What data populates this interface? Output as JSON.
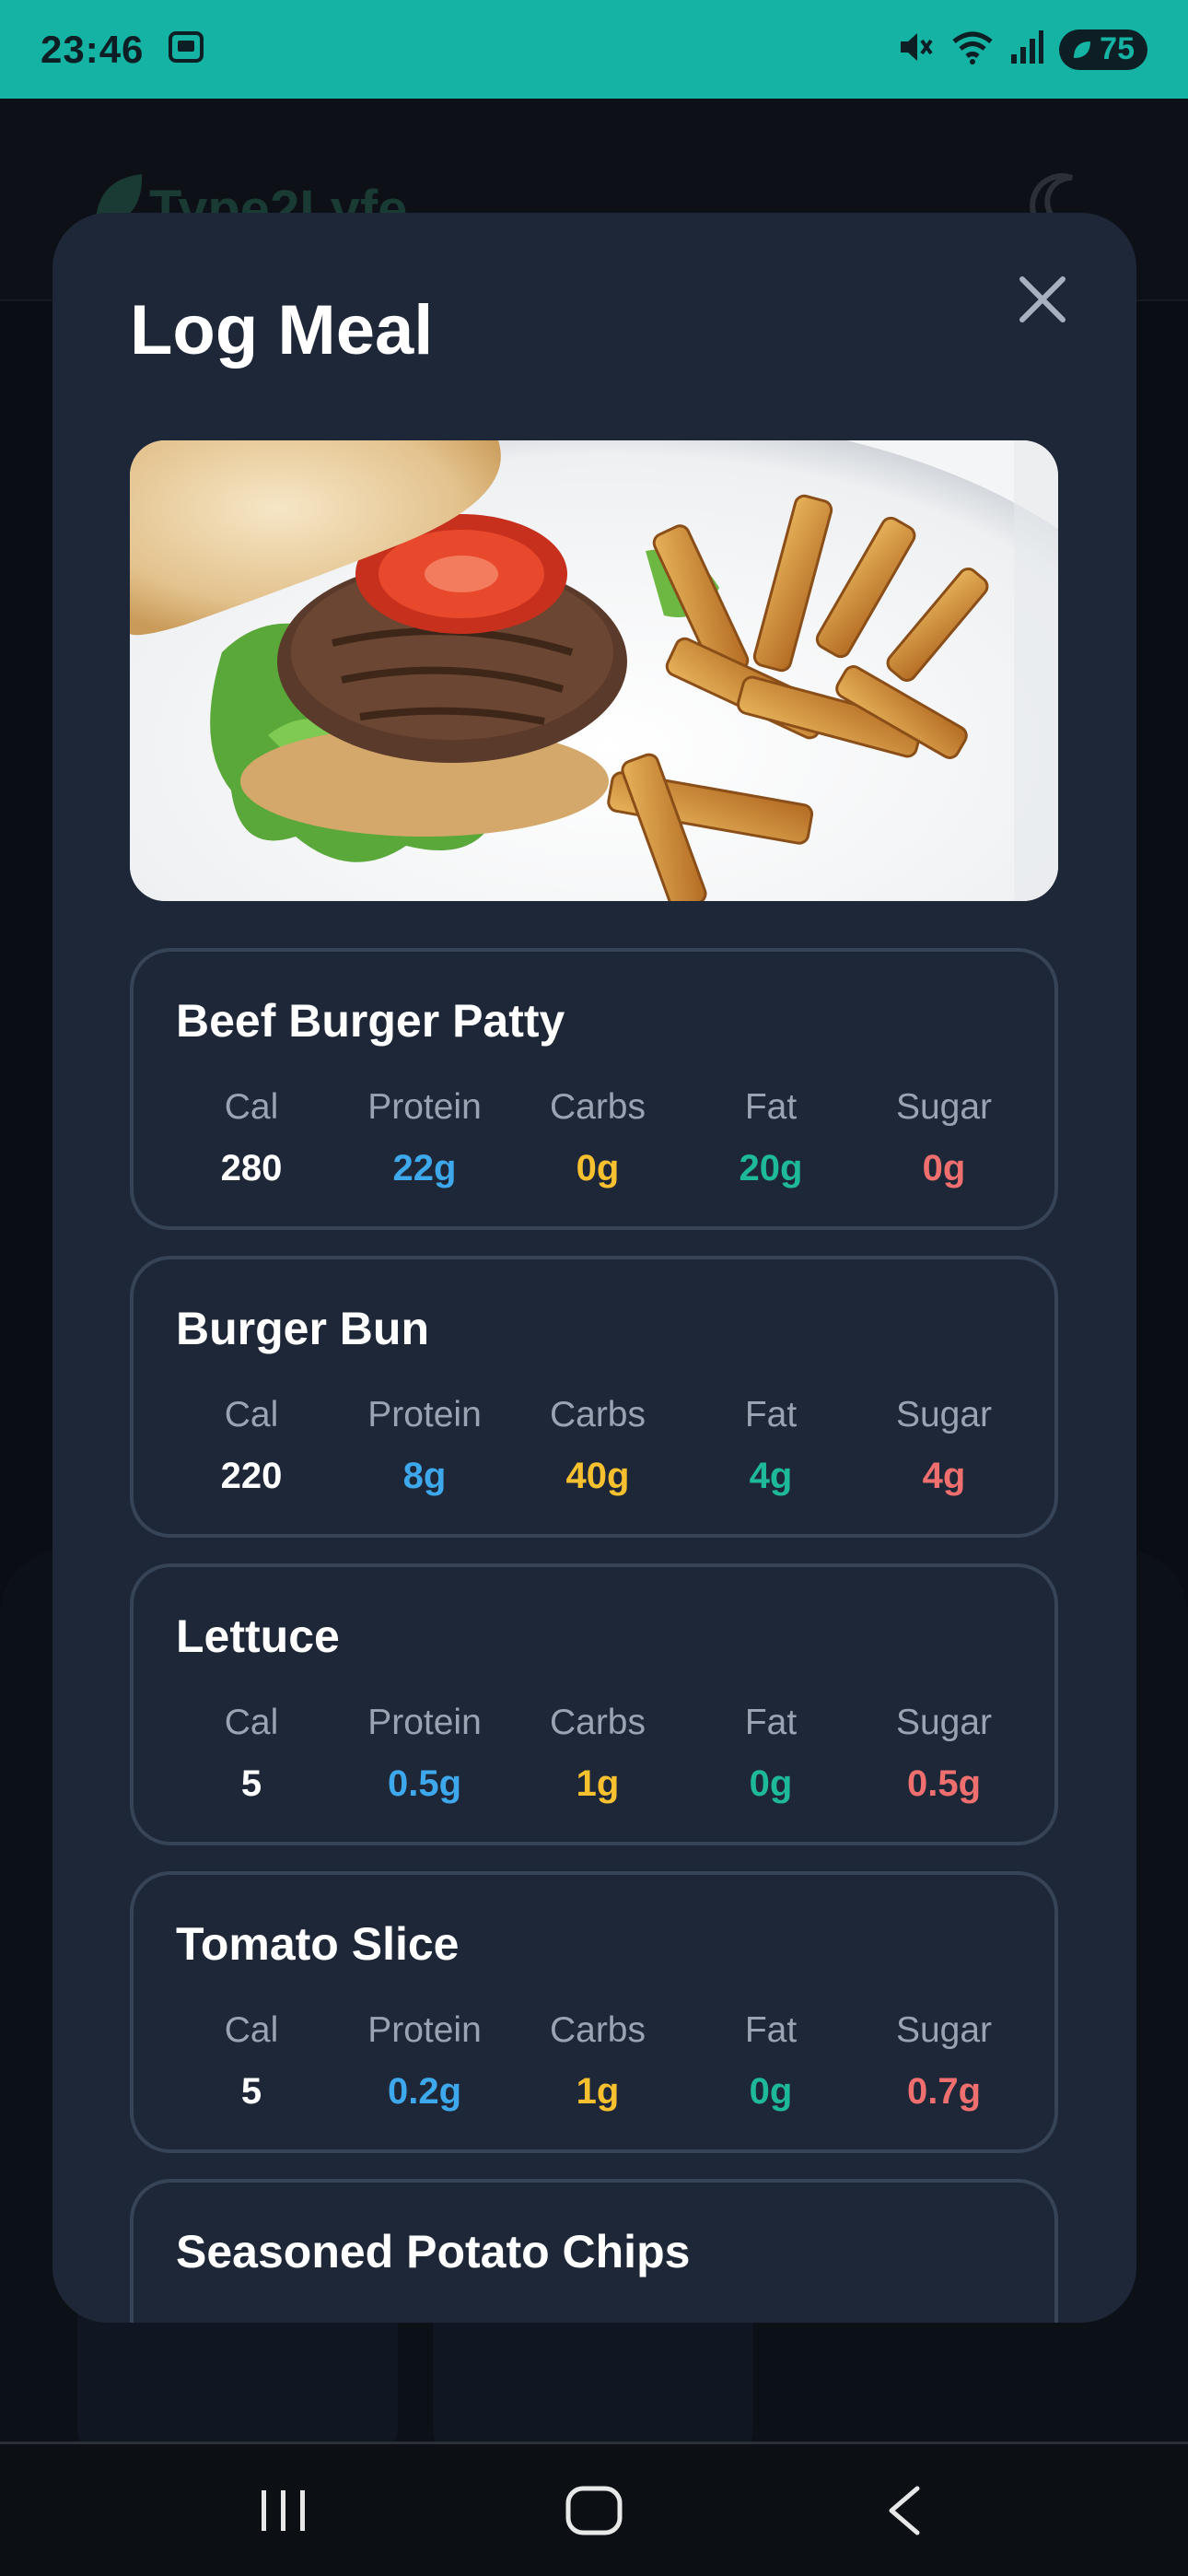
{
  "status_bar": {
    "time": "23:46",
    "battery": "75",
    "icons": [
      "screenshot-icon",
      "mute-icon",
      "wifi-icon",
      "signal-icon",
      "battery-icon"
    ]
  },
  "background_app": {
    "brand": "Type2Lyfe",
    "icons": [
      "leaf-icon",
      "moon-icon"
    ]
  },
  "modal": {
    "title": "Log Meal",
    "close_icon": "close-icon",
    "photo_icon": "burger-and-fries-photo",
    "columns": [
      "Cal",
      "Protein",
      "Carbs",
      "Fat",
      "Sugar"
    ],
    "items": [
      {
        "name": "Beef Burger Patty",
        "cal": "280",
        "protein": "22g",
        "carbs": "0g",
        "fat": "20g",
        "sugar": "0g"
      },
      {
        "name": "Burger Bun",
        "cal": "220",
        "protein": "8g",
        "carbs": "40g",
        "fat": "4g",
        "sugar": "4g"
      },
      {
        "name": "Lettuce",
        "cal": "5",
        "protein": "0.5g",
        "carbs": "1g",
        "fat": "0g",
        "sugar": "0.5g"
      },
      {
        "name": "Tomato Slice",
        "cal": "5",
        "protein": "0.2g",
        "carbs": "1g",
        "fat": "0g",
        "sugar": "0.7g"
      },
      {
        "name": "Seasoned Potato Chips"
      }
    ]
  },
  "colors": {
    "status_bar": "#14b3a3",
    "modal_bg": "#1e2738",
    "cal": "#ffffff",
    "protein": "#3ea8ec",
    "carbs": "#f7c02e",
    "fat": "#1eb89b",
    "sugar": "#ef6f6f"
  },
  "nav": {
    "icons": [
      "recents-icon",
      "home-icon",
      "back-icon"
    ]
  }
}
